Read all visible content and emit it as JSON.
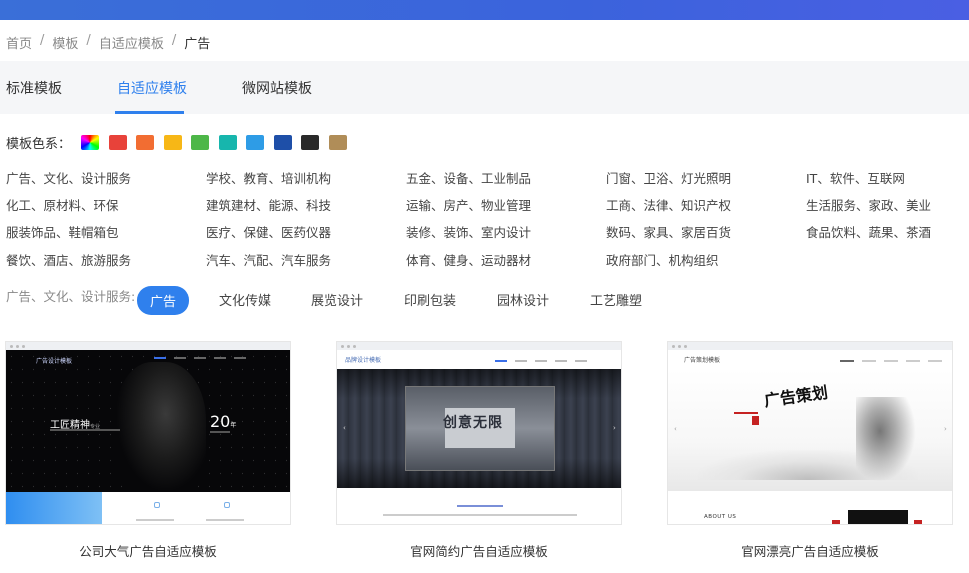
{
  "breadcrumb": {
    "items": [
      "首页",
      "模板",
      "自适应模板"
    ],
    "current": "广告"
  },
  "tabs": [
    {
      "label": "标准模板",
      "active": false
    },
    {
      "label": "自适应模板",
      "active": true
    },
    {
      "label": "微网站模板",
      "active": false
    }
  ],
  "colors": {
    "label": "模板色系：",
    "swatches": [
      "multicolor",
      "#e8423a",
      "#f26d32",
      "#f7b716",
      "#4db748",
      "#17b6ad",
      "#2e9ce6",
      "#1e4fa8",
      "#2a2a2a",
      "#b08d58"
    ]
  },
  "categories": [
    [
      "广告、文化、设计服务",
      "学校、教育、培训机构",
      "五金、设备、工业制品",
      "门窗、卫浴、灯光照明",
      "IT、软件、互联网"
    ],
    [
      "化工、原材料、环保",
      "建筑建材、能源、科技",
      "运输、房产、物业管理",
      "工商、法律、知识产权",
      "生活服务、家政、美业"
    ],
    [
      "服装饰品、鞋帽箱包",
      "医疗、保健、医药仪器",
      "装修、装饰、室内设计",
      "数码、家具、家居百货",
      "食品饮料、蔬果、茶酒"
    ],
    [
      "餐饮、酒店、旅游服务",
      "汽车、汽配、汽车服务",
      "体育、健身、运动器材",
      "政府部门、机构组织"
    ]
  ],
  "subcategory": {
    "label": "广告、文化、设计服务:",
    "items": [
      {
        "label": "广告",
        "active": true
      },
      {
        "label": "文化传媒",
        "active": false
      },
      {
        "label": "展览设计",
        "active": false
      },
      {
        "label": "印刷包装",
        "active": false
      },
      {
        "label": "园林设计",
        "active": false
      },
      {
        "label": "工艺雕塑",
        "active": false
      }
    ]
  },
  "templates": [
    {
      "title": "公司大气广告自适应模板",
      "preview": {
        "logo": "广告设计模板",
        "slogan": "工匠精神",
        "slogan_small": "专业",
        "number": "20",
        "number_unit": "年"
      }
    },
    {
      "title": "官网简约广告自适应模板",
      "preview": {
        "logo": "品牌设计模板",
        "headline": "创意无限"
      }
    },
    {
      "title": "官网漂亮广告自适应模板",
      "preview": {
        "logo": "广告策划模板",
        "callig": "广告策划",
        "about": "ABOUT US"
      }
    }
  ]
}
